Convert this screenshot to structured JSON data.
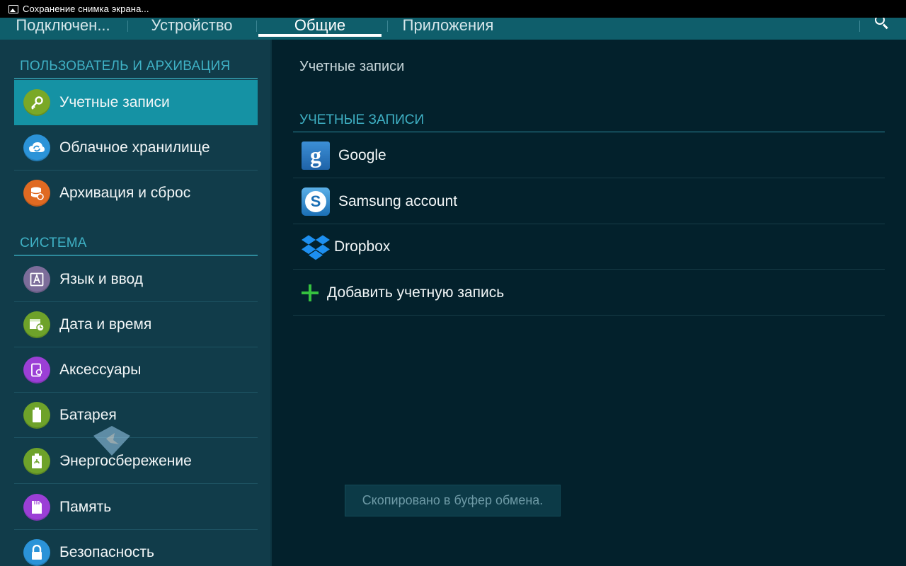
{
  "status_bar": {
    "notification_icon": "image-icon",
    "text": "Сохранение снимка экрана..."
  },
  "tabs": [
    {
      "label": "Подключен...",
      "active": false
    },
    {
      "label": "Устройство",
      "active": false
    },
    {
      "label": "Общие",
      "active": true
    },
    {
      "label": "Приложения",
      "active": false
    }
  ],
  "search_icon": "search-icon",
  "sidebar": {
    "sections": [
      {
        "header": "ПОЛЬЗОВАТЕЛЬ И АРХИВАЦИЯ",
        "items": [
          {
            "label": "Учетные записи",
            "icon": "key-icon",
            "color": "#7aa826",
            "selected": true
          },
          {
            "label": "Облачное хранилище",
            "icon": "cloud-sync-icon",
            "color": "#2b93d8",
            "selected": false
          },
          {
            "label": "Архивация и сброс",
            "icon": "backup-icon",
            "color": "#e06a22",
            "selected": false
          }
        ]
      },
      {
        "header": "СИСТЕМА",
        "items": [
          {
            "label": "Язык и ввод",
            "icon": "language-icon",
            "color": "#7c6d9a",
            "selected": false
          },
          {
            "label": "Дата и время",
            "icon": "calendar-clock-icon",
            "color": "#6ea22a",
            "selected": false
          },
          {
            "label": "Аксессуары",
            "icon": "accessory-icon",
            "color": "#9b3fd6",
            "selected": false
          },
          {
            "label": "Батарея",
            "icon": "battery-icon",
            "color": "#6ea22a",
            "selected": false
          },
          {
            "label": "Энергосбережение",
            "icon": "power-saving-icon",
            "color": "#6ea22a",
            "selected": false
          },
          {
            "label": "Память",
            "icon": "memory-icon",
            "color": "#9b3fd6",
            "selected": false
          },
          {
            "label": "Безопасность",
            "icon": "lock-icon",
            "color": "#2b93d8",
            "selected": false
          }
        ]
      }
    ]
  },
  "main": {
    "title": "Учетные записи",
    "section_header": "УЧЕТНЫЕ ЗАПИСИ",
    "accounts": [
      {
        "label": "Google",
        "icon": "google-icon"
      },
      {
        "label": "Samsung account",
        "icon": "samsung-account-icon"
      },
      {
        "label": "Dropbox",
        "icon": "dropbox-icon"
      }
    ],
    "add_account": {
      "label": "Добавить учетную запись",
      "icon": "plus-icon"
    }
  },
  "toast": "Скопировано в буфер обмена."
}
